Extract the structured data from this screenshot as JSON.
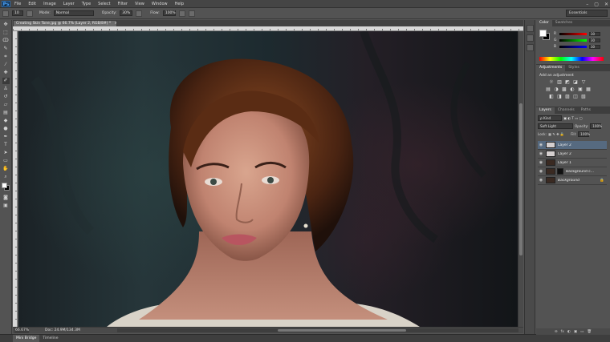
{
  "app": {
    "logo": "Ps",
    "menu": [
      "File",
      "Edit",
      "Image",
      "Layer",
      "Type",
      "Select",
      "Filter",
      "View",
      "Window",
      "Help"
    ],
    "window_controls": [
      "–",
      "▢",
      "✕"
    ]
  },
  "options_bar": {
    "brush_size": "10",
    "mode_label": "Mode:",
    "mode_value": "Normal",
    "opacity_label": "Opacity:",
    "opacity_value": "30%",
    "flow_label": "Flow:",
    "flow_value": "100%",
    "workspace": "Essentials"
  },
  "document": {
    "tab_title": "Creating Skin Tone.jpg @ 66.7% (Layer 2, RGB/8#) *",
    "tab_close": "×",
    "zoom": "66.67%",
    "doc_info": "Doc: 24.9M/134.3M"
  },
  "bottom_tabs": [
    "Mini Bridge",
    "Timeline"
  ],
  "color_panel": {
    "tabs": [
      "Color",
      "Swatches"
    ],
    "fg_color": "#ffffff",
    "bg_color": "#000000",
    "channels": [
      {
        "label": "R",
        "value": "30"
      },
      {
        "label": "G",
        "value": "30"
      },
      {
        "label": "B",
        "value": "30"
      }
    ]
  },
  "adjustments_panel": {
    "tabs": [
      "Adjustments",
      "Styles"
    ],
    "title": "Add an adjustment",
    "row1": [
      "☼",
      "▥",
      "◩",
      "◪",
      "▽"
    ],
    "row2": [
      "▤",
      "◑",
      "▩",
      "◐",
      "▣",
      "▦"
    ],
    "row3": [
      "◧",
      "◨",
      "▨",
      "◫",
      "▧"
    ]
  },
  "layers_panel": {
    "tabs": [
      "Layers",
      "Channels",
      "Paths"
    ],
    "filter_kind": "ρ Kind",
    "blend_mode": "Soft Light",
    "opacity_label": "Opacity:",
    "opacity_value": "100%",
    "lock_label": "Lock:",
    "fill_label": "Fill:",
    "fill_value": "100%",
    "layers": [
      {
        "name": "Layer 2",
        "selected": true,
        "italic": false,
        "lock": ""
      },
      {
        "name": "Layer 2",
        "selected": false,
        "italic": false,
        "lock": ""
      },
      {
        "name": "Layer 1",
        "selected": false,
        "italic": false,
        "lock": ""
      },
      {
        "name": "Background c...",
        "selected": false,
        "italic": false,
        "lock": ""
      },
      {
        "name": "Background",
        "selected": false,
        "italic": true,
        "lock": "🔒"
      }
    ],
    "footer_icons": [
      "⊖",
      "fx",
      "◐",
      "▣",
      "▭",
      "🗑"
    ]
  },
  "colors": {
    "accent_selected_layer": "#566a80",
    "panel_bg": "#535353",
    "menubar_bg": "#454545"
  }
}
